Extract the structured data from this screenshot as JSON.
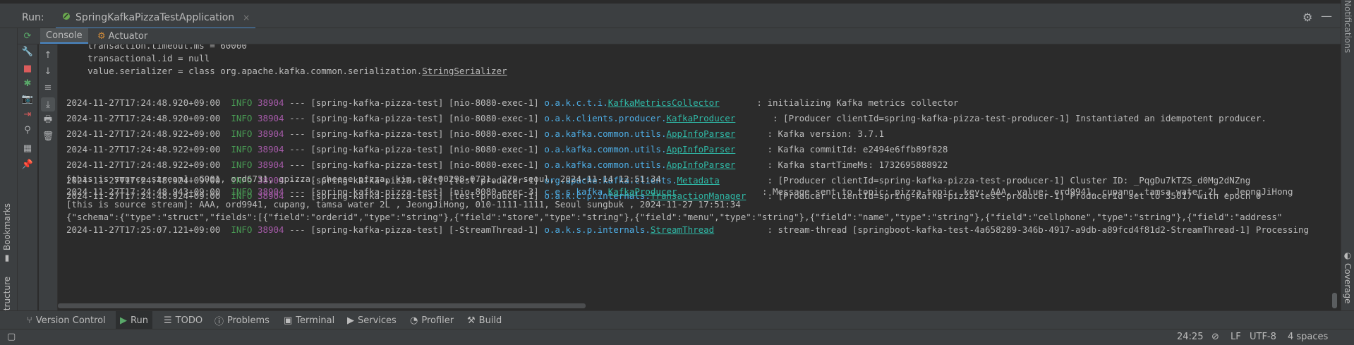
{
  "run_header": {
    "label": "Run:",
    "tab_title": "SpringKafkaPizzaTestApplication",
    "close_glyph": "×"
  },
  "subtabs": {
    "console": "Console",
    "actuator": "Actuator"
  },
  "side_tabs": {
    "bookmarks": "Bookmarks",
    "structure": "Structure",
    "notifications": "Notifications",
    "coverage": "Coverage"
  },
  "console_lines": {
    "l0": "    transaction.timeout.ms = 60000",
    "l1": "    transactional.id = null",
    "l2a": "    value.serializer = class org.apache.kafka.common.serialization.",
    "l2b": "StringSerializer",
    "logs": [
      {
        "ts": "2024-11-27T17:24:48.920+09:00",
        "level": "INFO",
        "pid": "38904",
        "thread": "--- [spring-kafka-pizza-test] [nio-8080-exec-1]",
        "pkg": "o.a.k.c.t.i.",
        "cls": "KafkaMetricsCollector",
        "pad": "       ",
        "msg": ": initializing Kafka metrics collector"
      },
      {
        "ts": "2024-11-27T17:24:48.920+09:00",
        "level": "INFO",
        "pid": "38904",
        "thread": "--- [spring-kafka-pizza-test] [nio-8080-exec-1]",
        "pkg": "o.a.k.clients.producer.",
        "cls": "KafkaProducer",
        "pad": "       ",
        "msg": ": [Producer clientId=spring-kafka-pizza-test-producer-1] Instantiated an idempotent producer."
      },
      {
        "ts": "2024-11-27T17:24:48.922+09:00",
        "level": "INFO",
        "pid": "38904",
        "thread": "--- [spring-kafka-pizza-test] [nio-8080-exec-1]",
        "pkg": "o.a.kafka.common.utils.",
        "cls": "AppInfoParser",
        "pad": "      ",
        "msg": ": Kafka version: 3.7.1"
      },
      {
        "ts": "2024-11-27T17:24:48.922+09:00",
        "level": "INFO",
        "pid": "38904",
        "thread": "--- [spring-kafka-pizza-test] [nio-8080-exec-1]",
        "pkg": "o.a.kafka.common.utils.",
        "cls": "AppInfoParser",
        "pad": "      ",
        "msg": ": Kafka commitId: e2494e6ffb89f828"
      },
      {
        "ts": "2024-11-27T17:24:48.922+09:00",
        "level": "INFO",
        "pid": "38904",
        "thread": "--- [spring-kafka-pizza-test] [nio-8080-exec-1]",
        "pkg": "o.a.kafka.common.utils.",
        "cls": "AppInfoParser",
        "pad": "      ",
        "msg": ": Kafka startTimeMs: 1732695888922"
      },
      {
        "ts": "2024-11-27T17:24:48.924+09:00",
        "level": "INFO",
        "pid": "38904",
        "thread": "--- [spring-kafka-pizza-test] [test-producer-1]",
        "pkg": "org.apache.kafka.clients.",
        "cls": "Metadata",
        "pad": "         ",
        "msg": ": [Producer clientId=spring-kafka-pizza-test-producer-1] Cluster ID: _PqgDu7kTZS_d0Mg2dNZng"
      },
      {
        "ts": "2024-11-27T17:24:48.924+09:00",
        "level": "INFO",
        "pid": "38904",
        "thread": "--- [spring-kafka-pizza-test] [test-producer-1]",
        "pkg": "o.a.k.c.p.internals.",
        "cls": "TransactionManager",
        "pad": "    ",
        "msg": ": [Producer clientId=spring-kafka-pizza-test-producer-1] ProducerId set to 35017 with epoch 0"
      }
    ],
    "stream1": "[this is source stream]: G001, ord6731, gpizza, cheese pizza, kim, 07-00298-0721, 279 seoul, 2024-11-14 12:51:34",
    "log8": {
      "ts": "2024-11-27T17:24:48.943+09:00",
      "level": "INFO",
      "pid": "38904",
      "thread": "--- [spring-kafka-pizza-test] [nio-8080-exec-3]",
      "pkg": "c.e.s.kafka.",
      "cls": "KafkaProducer",
      "pad": "                ",
      "msg": ": Message sent to topic: pizza-topic, key: AAA, value: ord9941, cupang, tamsa water 2L , JeongJiHong"
    },
    "stream2": "[this is source stream]: AAA, ord9941, cupang, tamsa water 2L , JeongJiHong, 010-1111-1111, Seoul sungbuk , 2024-11-27 17:51:34",
    "schema": "{\"schema\":{\"type\":\"struct\",\"fields\":[{\"field\":\"orderid\",\"type\":\"string\"},{\"field\":\"store\",\"type\":\"string\"},{\"field\":\"menu\",\"type\":\"string\"},{\"field\":\"name\",\"type\":\"string\"},{\"field\":\"cellphone\",\"type\":\"string\"},{\"field\":\"address\"",
    "log11": {
      "ts": "2024-11-27T17:25:07.121+09:00",
      "level": "INFO",
      "pid": "38904",
      "thread": "--- [spring-kafka-pizza-test] [-StreamThread-1]",
      "pkg": "o.a.k.s.p.internals.",
      "cls": "StreamThread",
      "pad": "          ",
      "msg": ": stream-thread [springboot-kafka-test-4a658289-346b-4917-a9db-a89fcd4f81d2-StreamThread-1] Processing"
    }
  },
  "bottom_tabs": {
    "version_control": "Version Control",
    "run": "Run",
    "todo": "TODO",
    "problems": "Problems",
    "terminal": "Terminal",
    "services": "Services",
    "profiler": "Profiler",
    "build": "Build"
  },
  "status_bar": {
    "position": "24:25",
    "line_sep": "LF",
    "encoding": "UTF-8",
    "indent": "4 spaces"
  },
  "icons": {
    "rerun": "rerun-icon",
    "stop": "stop-icon",
    "gear": "gear-icon",
    "minimize": "minimize-icon"
  },
  "colors": {
    "accent": "#4a88c7",
    "info": "#499c54",
    "pid": "#a55aa8",
    "logger": "#2fb8a6"
  }
}
